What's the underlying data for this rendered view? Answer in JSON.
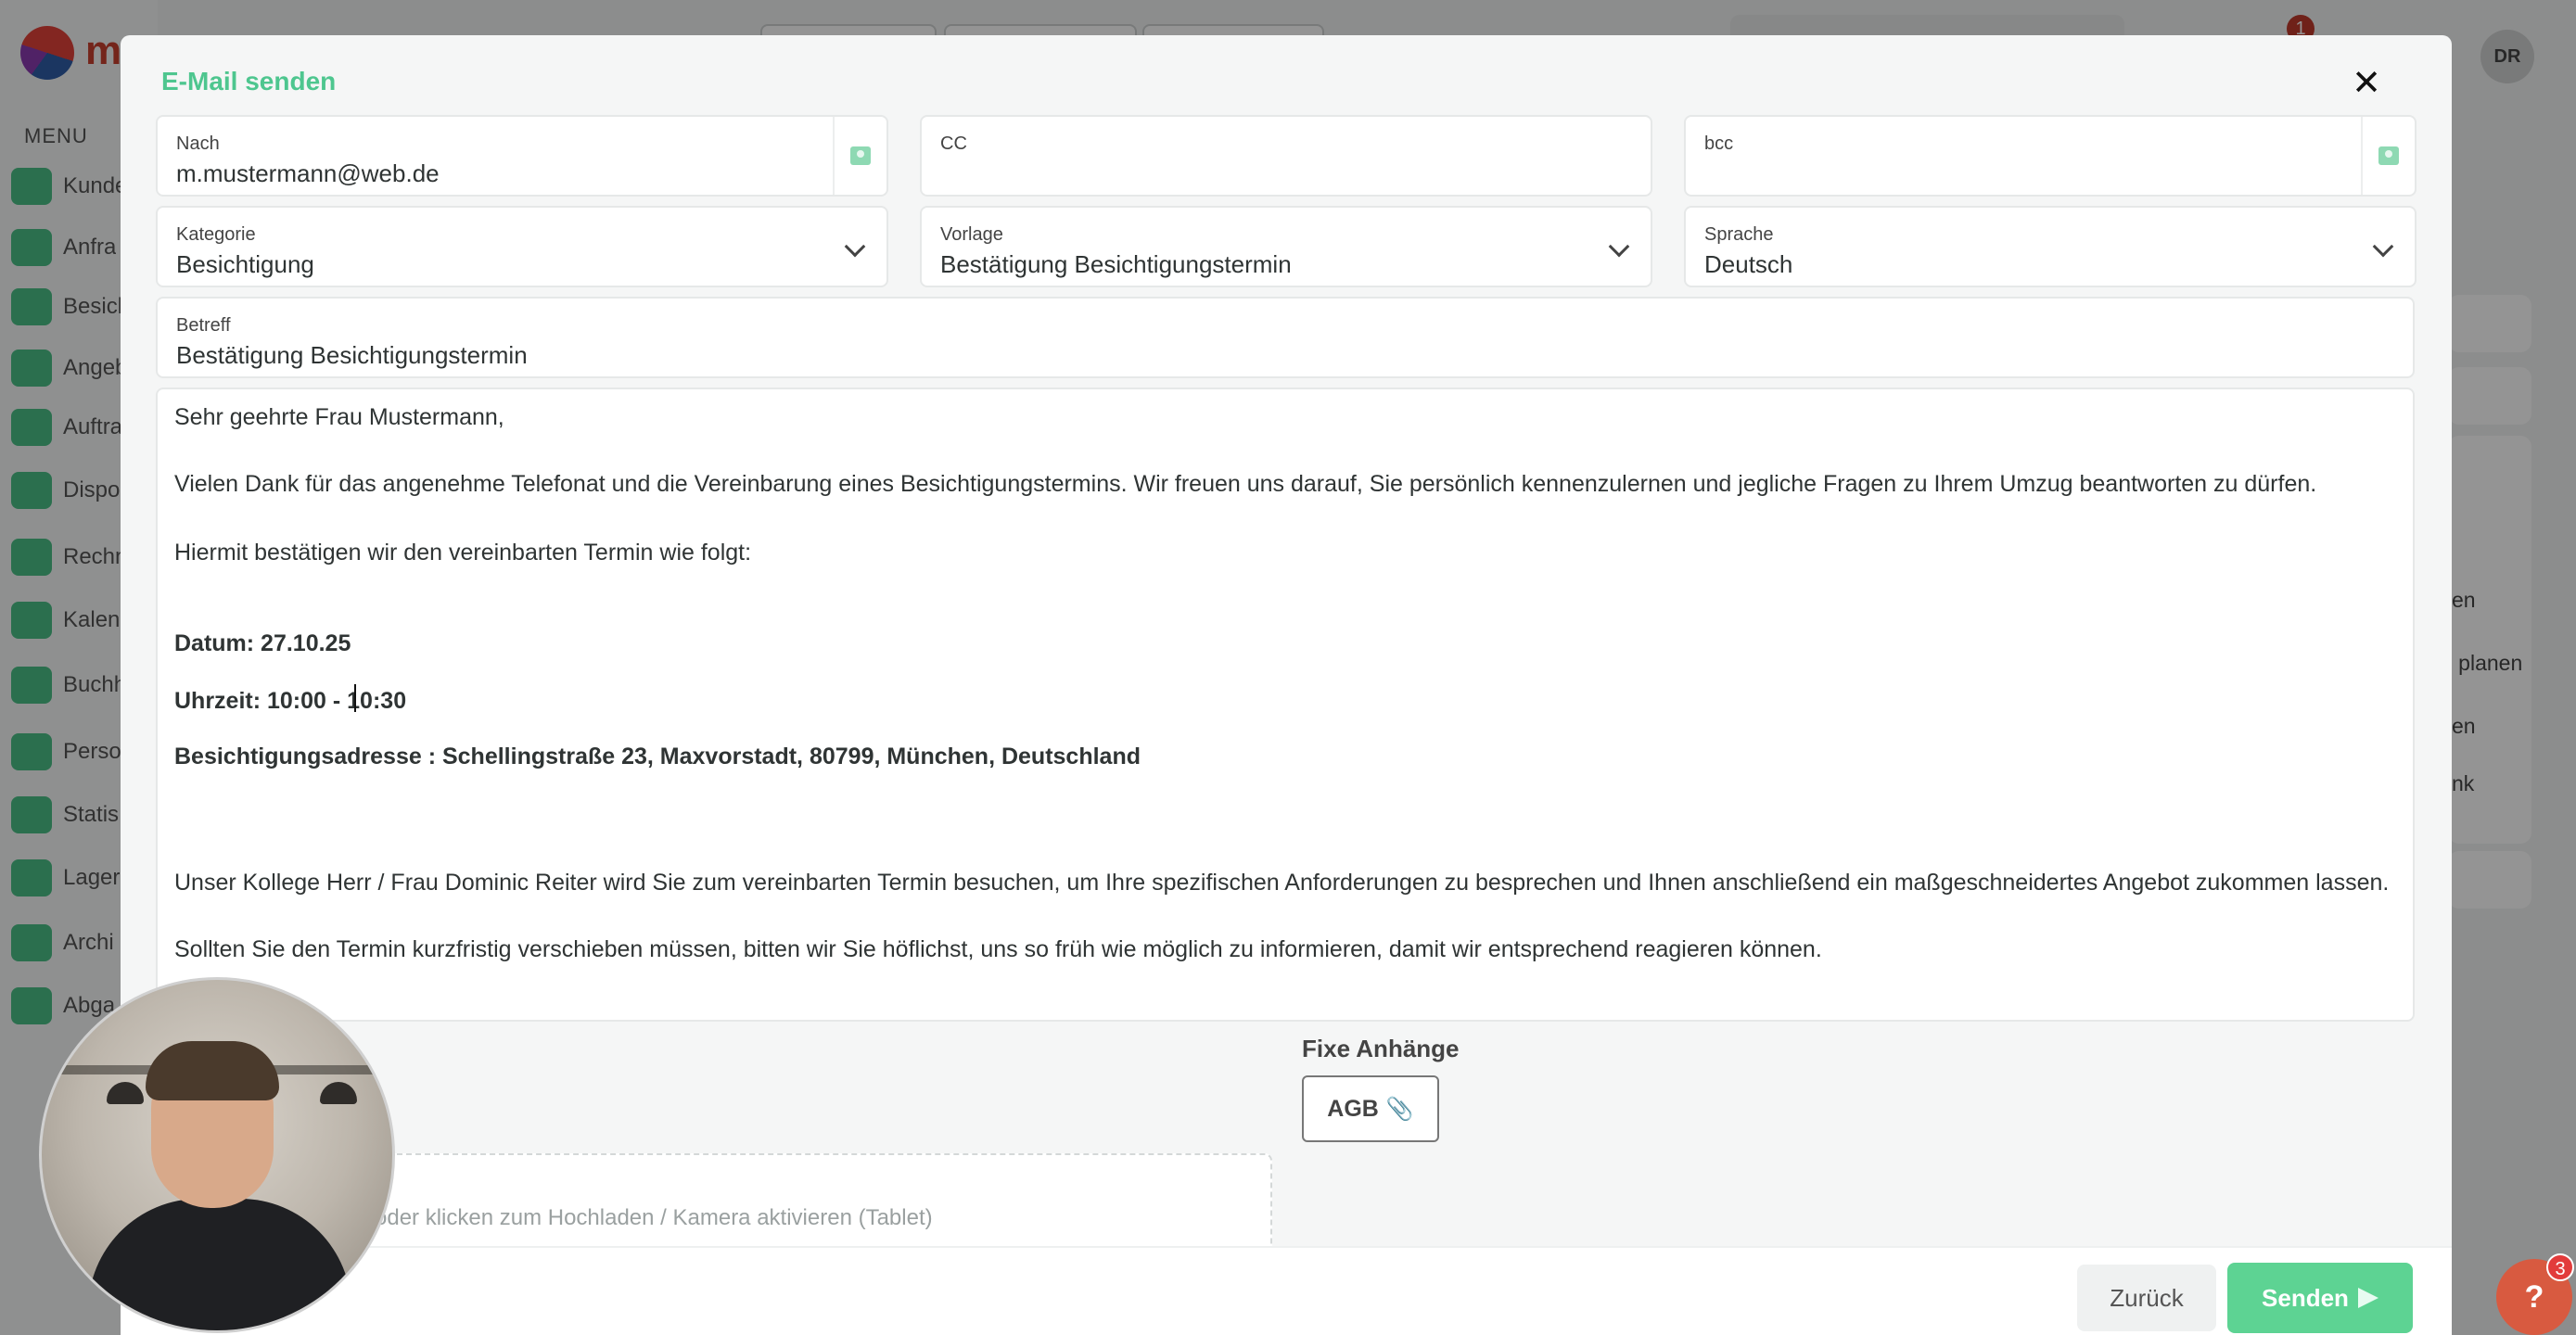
{
  "background": {
    "logo_letter": "m",
    "menu_label": "MENU",
    "sidebar_items": [
      "Kunde",
      "Anfra",
      "Besicl",
      "Angeb",
      "Auftra",
      "Dispo",
      "Rechn",
      "Kalen",
      "Buchh",
      "Perso",
      "Statis",
      "Lager",
      "Archi",
      "Abga"
    ],
    "notification_count": "1",
    "user_initials": "DR",
    "right_texts": [
      "en",
      "g planen",
      "en",
      "nk"
    ]
  },
  "modal": {
    "title": "E-Mail senden",
    "close_icon": "close-icon",
    "to": {
      "label": "Nach",
      "value": "m.mustermann@web.de"
    },
    "cc": {
      "label": "CC",
      "value": ""
    },
    "bcc": {
      "label": "bcc",
      "value": ""
    },
    "category": {
      "label": "Kategorie",
      "value": "Besichtigung"
    },
    "template": {
      "label": "Vorlage",
      "value": "Bestätigung Besichtigungstermin"
    },
    "language": {
      "label": "Sprache",
      "value": "Deutsch"
    },
    "subject": {
      "label": "Betreff",
      "value": "Bestätigung Besichtigungstermin"
    },
    "body": {
      "greeting": "Sehr geehrte Frau Mustermann,",
      "p1": "Vielen Dank für das angenehme Telefonat und die Vereinbarung eines Besichtigungstermins. Wir freuen uns darauf, Sie persönlich kennenzulernen und jegliche Fragen zu Ihrem Umzug beantworten zu dürfen.",
      "p2": "Hiermit bestätigen wir den vereinbarten Termin wie folgt:",
      "date": "Datum: 27.10.25",
      "time": "Uhrzeit: 10:00 - 10:30",
      "address": "Besichtigungsadresse : Schellingstraße 23, Maxvorstadt, 80799, München, Deutschland",
      "p3": "Unser Kollege Herr / Frau Dominic Reiter wird Sie zum vereinbarten Termin besuchen, um Ihre spezifischen Anforderungen zu besprechen und Ihnen anschließend ein maßgeschneidertes Angebot zukommen lassen.",
      "p4": "Sollten Sie den Termin kurzfristig verschieben müssen, bitten wir Sie höflichst, uns so früh wie möglich zu informieren, damit wir entsprechend reagieren können."
    },
    "fixed_attachments": {
      "title": "Fixe Anhänge",
      "items": [
        "AGB"
      ]
    },
    "upload_hint": "oder klicken zum Hochladen / Kamera aktivieren (Tablet)",
    "back_label": "Zurück",
    "send_label": "Senden"
  },
  "help": {
    "label": "?",
    "badge": "3"
  },
  "colors": {
    "accent": "#4ec68f",
    "send_button": "#5dd393",
    "help": "#d85a40"
  }
}
